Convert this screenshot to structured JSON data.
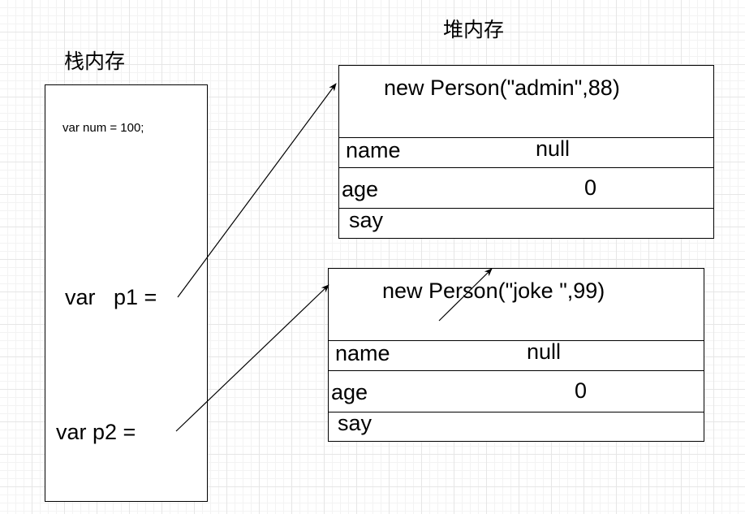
{
  "stack": {
    "title": "栈内存",
    "num_line": "var num = 100;",
    "p1_line": "var   p1 =",
    "p2_line": "var p2 ="
  },
  "heap": {
    "title": "堆内存",
    "objects": [
      {
        "header": "new Person(\"admin\",88)",
        "fields": [
          {
            "name": "name",
            "value": "null"
          },
          {
            "name": "age",
            "value": "0"
          },
          {
            "name": "say",
            "value": ""
          }
        ]
      },
      {
        "header": "new Person(\"joke \",99)",
        "fields": [
          {
            "name": "name",
            "value": "null"
          },
          {
            "name": "age",
            "value": "0"
          },
          {
            "name": "say",
            "value": ""
          }
        ]
      }
    ]
  }
}
